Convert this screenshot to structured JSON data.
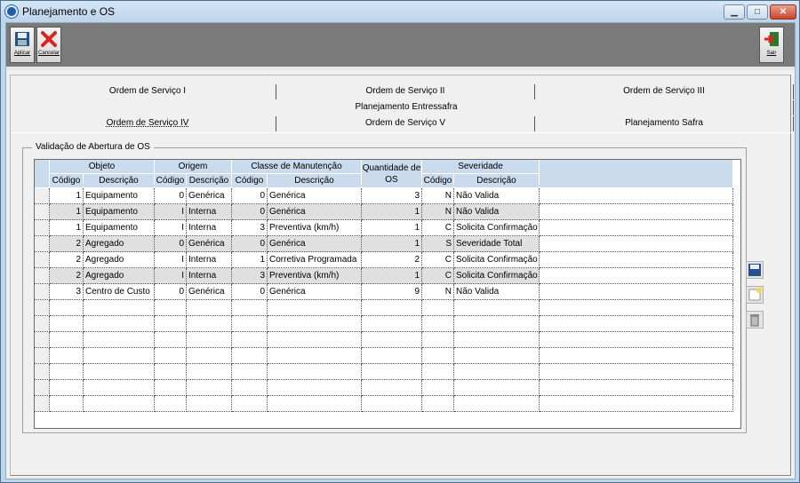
{
  "window": {
    "title": "Planejamento e OS"
  },
  "toolbar": {
    "apply_label": "Aplicar",
    "cancel_label": "Cancelar",
    "exit_label": "Sair"
  },
  "tabs": {
    "row1": [
      "Ordem de Serviço I",
      "Ordem de Serviço II",
      "Ordem de Serviço III"
    ],
    "row2": [
      "Planejamento Entressafra"
    ],
    "row3": [
      "Ordem de Serviço IV",
      "Ordem de Serviço V",
      "Planejamento Safra"
    ],
    "active": "Ordem de Serviço IV"
  },
  "frame": {
    "title": "Validação de Abertura de OS"
  },
  "grid": {
    "groups": [
      "Objeto",
      "Origem",
      "Classe de Manutenção",
      "Quantidade de OS",
      "Severidade"
    ],
    "subheaders": [
      "Código",
      "Descrição",
      "Código",
      "Descrição",
      "Código",
      "Descrição",
      "Código",
      "Descrição"
    ],
    "rows": [
      [
        "1",
        "Equipamento",
        "0",
        "Genérica",
        "0",
        "Genérica",
        "3",
        "N",
        "Não Valida"
      ],
      [
        "1",
        "Equipamento",
        "I",
        "Interna",
        "0",
        "Genérica",
        "1",
        "N",
        "Não Valida"
      ],
      [
        "1",
        "Equipamento",
        "I",
        "Interna",
        "3",
        "Preventiva (km/h)",
        "1",
        "C",
        "Solicita Confirmação"
      ],
      [
        "2",
        "Agregado",
        "0",
        "Genérica",
        "0",
        "Genérica",
        "1",
        "S",
        "Severidade Total"
      ],
      [
        "2",
        "Agregado",
        "I",
        "Interna",
        "1",
        "Corretiva Programada",
        "2",
        "C",
        "Solicita Confirmação"
      ],
      [
        "2",
        "Agregado",
        "I",
        "Interna",
        "3",
        "Preventiva (km/h)",
        "1",
        "C",
        "Solicita Confirmação"
      ],
      [
        "3",
        "Centro de Custo",
        "0",
        "Genérica",
        "0",
        "Genérica",
        "9",
        "N",
        "Não Valida"
      ]
    ],
    "empty_rows": 7,
    "shaded_rows": [
      1,
      3,
      5
    ]
  },
  "side_buttons": [
    "save-icon",
    "new-icon",
    "delete-icon"
  ],
  "colors": {
    "header": "#c9dbec",
    "shaded_row": "#e0e0e0",
    "toolbar": "#7a7a7a"
  }
}
